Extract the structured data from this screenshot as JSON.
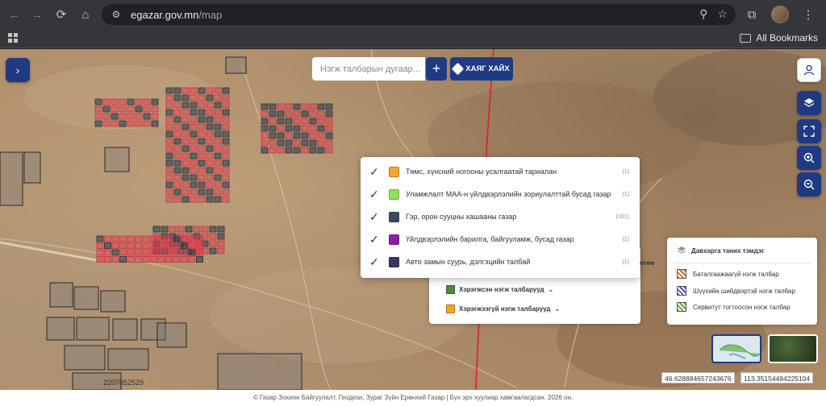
{
  "browser": {
    "url_host": "egazar.gov.mn",
    "url_path": "/map",
    "all_bookmarks": "All Bookmarks"
  },
  "search": {
    "placeholder": "Нэгж талбарын дугаар...",
    "add_label": "+",
    "address_button": "ХАЯГ ХАЙХ"
  },
  "popup": {
    "items": [
      {
        "label": "Төмс, хүнсний ногооны усалгаатай тариалан",
        "count": "(1)",
        "color": "#f5a623"
      },
      {
        "label": "Уламжлалт МАА-н үйлдвэрлэлийн зориулалттай бусад газар",
        "count": "(1)",
        "color": "#8ce25a"
      },
      {
        "label": "Гэр, орон сууцны хашааны газар",
        "count": "(161)",
        "color": "#3b4a63"
      },
      {
        "label": "Үйлдвэрлэлийн барилга, байгууламж, бусад газар",
        "count": "(1)",
        "color": "#8e1fa6"
      },
      {
        "label": "Авто замын суурь, дэлгэцийн талбай",
        "count": "(1)",
        "color": "#3b3560"
      }
    ]
  },
  "panel2": {
    "tail_text": "лөгөө",
    "rows": [
      {
        "label": "Хэрэгжсэн нэгж талбарууд",
        "color": "#4e8a3a"
      },
      {
        "label": "Хэрэгжээгүй нэгж талбарууд",
        "color": "#f5a623"
      }
    ]
  },
  "legend": {
    "title": "Давхарга таних тэмдэг",
    "items": [
      {
        "label": "Баталгаажаагүй нэгж талбар"
      },
      {
        "label": "Шүүхийн шийдвэртэй нэгж талбар"
      },
      {
        "label": "Сервитут тогтоосон нэгж талбар"
      }
    ]
  },
  "coords": {
    "lat": "46.628884657243676",
    "lon": "113.35154484225104"
  },
  "map": {
    "parcel_label": "2207052529"
  },
  "footer": "© Газар Зохион Байгуулалт, Геодези, Зураг Зүйн Ерөнхий Газар | Бүх эрх хуулиар хамгаалагдсан. 2026 он.",
  "colors": {
    "primary": "#1f3a83",
    "road": "#e02020",
    "parcel_red": "#d43a4a",
    "parcel_dark": "#33404f"
  }
}
